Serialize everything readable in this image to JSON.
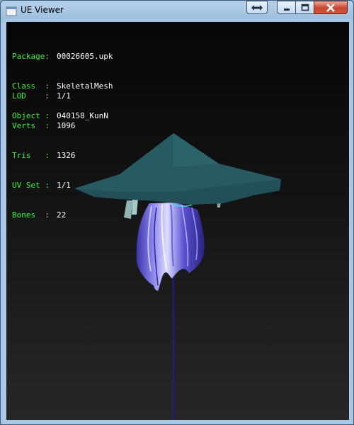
{
  "window": {
    "title": "UE Viewer",
    "controls": [
      "resize-icon",
      "minimize-icon",
      "maximize-icon",
      "close-icon"
    ]
  },
  "info": {
    "package": {
      "label": "Package:",
      "value": "00026605.upk"
    },
    "class": {
      "label": "Class  :",
      "value": "SkeletalMesh"
    },
    "object": {
      "label": "Object :",
      "value": "040158_KunN"
    },
    "lod": {
      "label": "LOD    :",
      "value": "1/1"
    },
    "verts": {
      "label": "Verts  :",
      "value": "1096"
    },
    "tris": {
      "label": "Tris   :",
      "value": "1326"
    },
    "uvset": {
      "label": "UV Set :",
      "value": "1/1"
    },
    "bones": {
      "label": "Bones  :",
      "value": "22"
    }
  },
  "colors": {
    "label": "#3df33d",
    "value": "#ffffff",
    "hat": "#27575f",
    "hair": "#5a52c8",
    "bone": "#1a1ab4"
  }
}
